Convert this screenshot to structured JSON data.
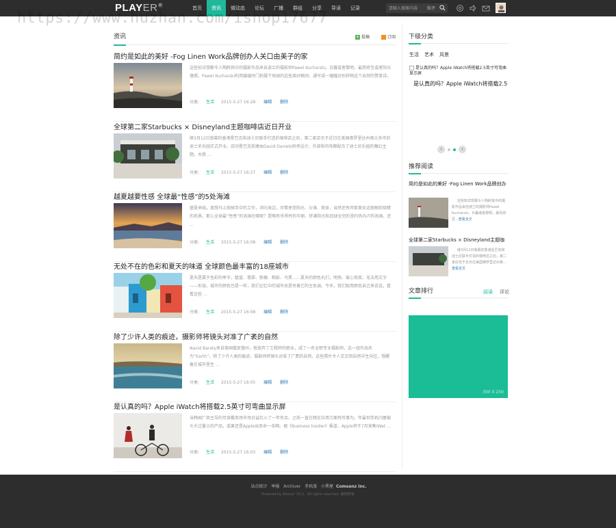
{
  "header": {
    "logo_main": "PLAY",
    "logo_er": "ER",
    "logo_sup": "听",
    "nav": [
      "首页",
      "资讯",
      "微动态",
      "论坛",
      "广播",
      "群组",
      "分享",
      "导读",
      "记录"
    ],
    "active_nav": "资讯",
    "search_placeholder": "请输入搜索内容",
    "search_scope": "帖子"
  },
  "watermark": "https://www.huzhan.com/ishop17677",
  "main": {
    "section_title": "资讯",
    "post_label": "投稿",
    "rss_label": "订阅",
    "articles": [
      {
        "title": "简约是如此的美好 -Fog Linen Work品牌创办人关口由美子的家",
        "excerpt": "这些知详想都令人陶醉其中的摄影作品来自波兰的摄影师Pawel Kucharski。日暮或者黎明，最而将至或者阳光落照。Pawel Kucharski利用缓缓时门拍摄下地球的这些美好瞬间，通写成一幅幅对别样物这个自然的赞美诗。",
        "category_label": "分类:",
        "category": "生活",
        "date": "2015-5-27 16:28",
        "edit": "编辑",
        "delete": "删除"
      },
      {
        "title": "全球第二家Starbucks × Disneyland主题咖啡店近日开业",
        "excerpt": "继3月12日南幕的香港星巴克和迪士尼联手打造的咖啡店之后，第二家店也于近日在美国佛罗里达州奥兰多市的迪士尼乐园正式开业。店间星巴克依建由David Daniels同师设计，外部和内饰都配合了迪士尼乐园的魔幻主题。木质 ...",
        "category_label": "分类:",
        "category": "生活",
        "date": "2015-5-27 16:27",
        "edit": "编辑",
        "delete": "删除"
      },
      {
        "title": "越夏越要性感 全球最“性感”的5处海滩",
        "excerpt": "盛夏来临，真想马上抛掉手中的工作，冲向海边，尽情享受阳光、沙滩、美食，当然还有岸那美女这般眼前吸睛的风景。那么全球最“性感”的海滩在哪呢？是略有世界杯的华丽、挤满阳光和冠球全完的里约热内卢的海滩。还 ...",
        "category_label": "分类:",
        "category": "生活",
        "date": "2015-5-27 16:08",
        "edit": "编辑",
        "delete": "删除"
      },
      {
        "title": "无处不在的色彩和夏天的味道 全球颜色最丰富的18座城市",
        "excerpt": "夏天是属于色彩的季节，靛蓝、翡翠、粉橡、鹤影、乌黑……夏天的颜色丸们，明快、爱心悦目。无法用文字——形容。城市的颜色也是一样，我们记忆中的城市总是有着它的主色调。今天，我们就用颜色自己来说话，看看这些 ...",
        "category_label": "分类:",
        "category": "生活",
        "date": "2015-5-27 16:08",
        "edit": "编辑",
        "delete": "删除"
      },
      {
        "title": "除了少许人类的痕迹，摄影师将镜头对准了广袤的自然",
        "excerpt": "Navid Baraty来自美国俄亥俄州，他放弃了工程师的职业，成了一名全职专业摄影师。这一组作品名为“Earth”，除了少许人类的痕迹，摄影师将镜头对准了广袤的自然。这些照片令人交叉回自然中生向往，想醒着在城市里生 ...",
        "category_label": "分类:",
        "category": "生活",
        "date": "2015-5-27 16:05",
        "edit": "编辑",
        "delete": "删除"
      },
      {
        "title": "是认真的吗？Apple iWatch将搭载2.5英寸可弯曲显示屏",
        "excerpt": "当韩国厂商主导的可穿戴商场市场日益红火了一年有余，之前一直在暗在应用方面有所事为。年最到手机闪屋被头大过量义的产品，或果还是Apple出否命一击啊。据《Business Insider》报道，Apple将于7月发售iWat ...",
        "category_label": "分类:",
        "category": "生活",
        "date": "2015-5-27 16:03",
        "edit": "编辑",
        "delete": "删除"
      }
    ]
  },
  "sidebar": {
    "subcategories_title": "下级分类",
    "subcategories": [
      "生活",
      "艺术",
      "风景"
    ],
    "slider_caption_small": "是认真的吗？Apple iWatch将搭载2.5英寸可弯曲显示屏",
    "slider_caption": "是认真的吗？Apple iWatch将搭载2.5",
    "slider_prev": "‹",
    "slider_next": "›",
    "recommend_title": "推荐阅读",
    "recommend": [
      {
        "title": "简约是如此的美好 -Fog Linen Work品牌创办",
        "excerpt": "这些知详想都令人陶醉其中的摄影作品来自波兰的摄影师Pawel Kucharski。日暮或者黎明，最而将至...",
        "more": "查看全文"
      },
      {
        "title": "全球第二家Starbucks × Disneyland主题咖",
        "excerpt": "继3月12日南幕的香港星巴克和迪士尼联手打造的咖啡店之后，第二家店也于近日在美国佛罗里达州奥...",
        "more": "查看全文"
      }
    ],
    "ranking_title": "文章排行",
    "ranking_tabs": [
      "阅读",
      "评论"
    ],
    "ad_size": "300 X 250",
    "accent": "#1fb89a"
  },
  "footer": {
    "links": [
      "站点统计",
      "举报",
      "Archiver",
      "手机版",
      "小黑屋"
    ],
    "company": "Comsenz Inc.",
    "powered": "Powered by Discuz! X3.2 . All rights reserved. 版权所有"
  }
}
